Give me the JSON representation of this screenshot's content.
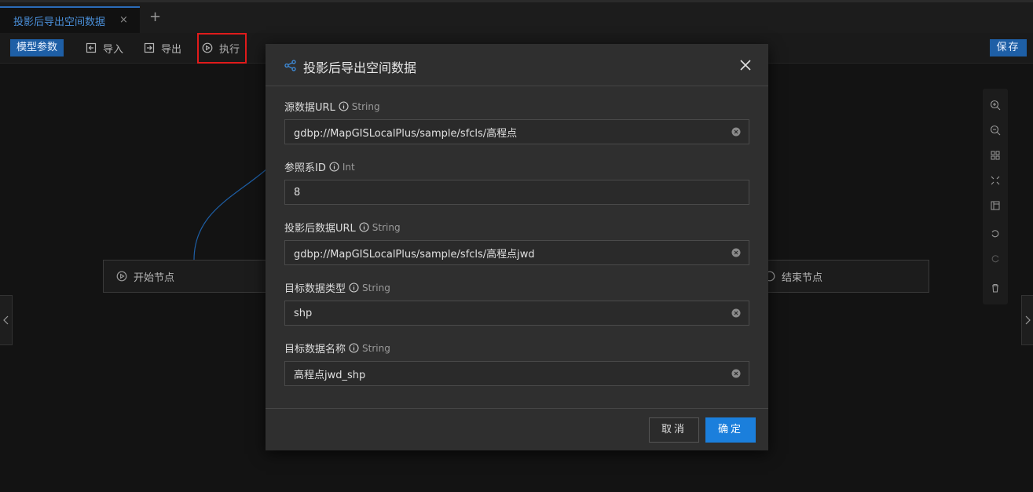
{
  "tabs": [
    {
      "label": "投影后导出空间数据",
      "close": "×"
    }
  ],
  "tab_add": "+",
  "toolbar": {
    "model_params": "模型参数",
    "import_label": "导入",
    "export_label": "导出",
    "execute_label": "执行",
    "save_label": "保存"
  },
  "canvas": {
    "start_node": "开始节点",
    "end_node": "结束节点"
  },
  "dialog": {
    "title": "投影后导出空间数据",
    "fields": [
      {
        "label": "源数据URL",
        "type": "String",
        "value": "gdbp://MapGISLocalPlus/sample/sfcls/高程点",
        "clearable": true
      },
      {
        "label": "参照系ID",
        "type": "Int",
        "value": "8",
        "clearable": false
      },
      {
        "label": "投影后数据URL",
        "type": "String",
        "value": "gdbp://MapGISLocalPlus/sample/sfcls/高程点jwd",
        "clearable": true
      },
      {
        "label": "目标数据类型",
        "type": "String",
        "value": "shp",
        "clearable": true
      },
      {
        "label": "目标数据名称",
        "type": "String",
        "value": "高程点jwd_shp",
        "clearable": true
      }
    ],
    "cancel_label": "取消",
    "ok_label": "确定"
  },
  "colors": {
    "accent": "#1b7fdc",
    "highlight_border": "#e01b1b",
    "background": "#131313",
    "dialog_bg": "#2f2f2f"
  },
  "icons": [
    "close-icon",
    "plus-icon",
    "import-icon",
    "export-icon",
    "play-icon",
    "share-nodes-icon",
    "info-icon",
    "clear-icon",
    "zoom-in-icon",
    "zoom-out-icon",
    "grid-icon",
    "fit-icon",
    "layout-icon",
    "undo-icon",
    "redo-icon",
    "delete-icon",
    "chevron-left-icon",
    "chevron-right-icon"
  ]
}
